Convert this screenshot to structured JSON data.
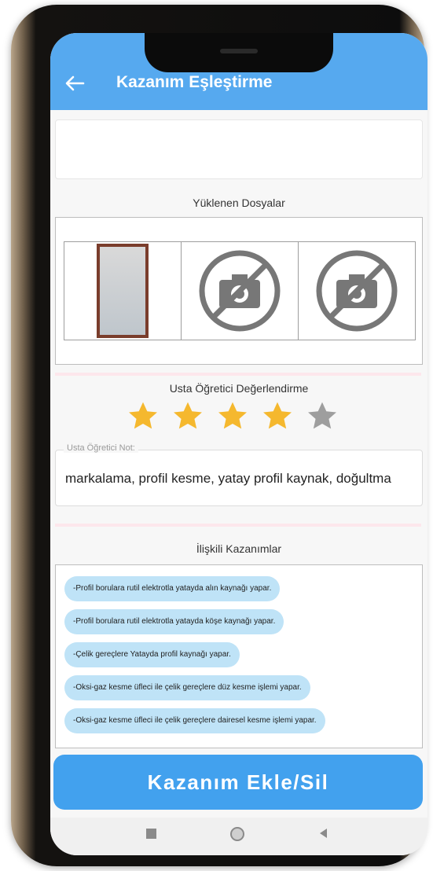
{
  "appbar": {
    "title": "Kazanım Eşleştirme",
    "back_icon": "arrow-left-icon"
  },
  "uploaded_files": {
    "label": "Yüklenen Dosyalar",
    "items": [
      {
        "type": "document-thumbnail"
      },
      {
        "type": "no-camera-icon"
      },
      {
        "type": "no-camera-icon"
      }
    ]
  },
  "rating": {
    "label": "Usta Öğretici Değerlendirme",
    "value": 4,
    "max": 5,
    "filled_color": "#f5b82e",
    "empty_color": "#9e9e9e"
  },
  "note": {
    "label": "Usta Öğretici Not:",
    "value": "markalama, profil kesme, yatay profil kaynak, doğultma"
  },
  "related": {
    "label": "İlişkili Kazanımlar",
    "items": [
      "-Profil borulara rutil elektrotla yatayda alın kaynağı yapar.",
      "-Profil borulara rutil elektrotla yatayda köşe kaynağı yapar.",
      "-Çelik gereçlere Yatayda profil kaynağı yapar.",
      "-Oksi-gaz kesme üfleci ile çelik gereçlere düz kesme işlemi yapar.",
      "-Oksi-gaz kesme üfleci ile çelik gereçlere dairesel kesme işlemi yapar."
    ]
  },
  "action_button": {
    "label": "Kazanım Ekle/Sil"
  },
  "colors": {
    "appbar": "#56a9ef",
    "button": "#42a1ee",
    "chip": "#bfe3f7"
  },
  "navbar": {
    "icons": [
      "recents-square-icon",
      "home-circle-icon",
      "back-triangle-icon"
    ]
  }
}
